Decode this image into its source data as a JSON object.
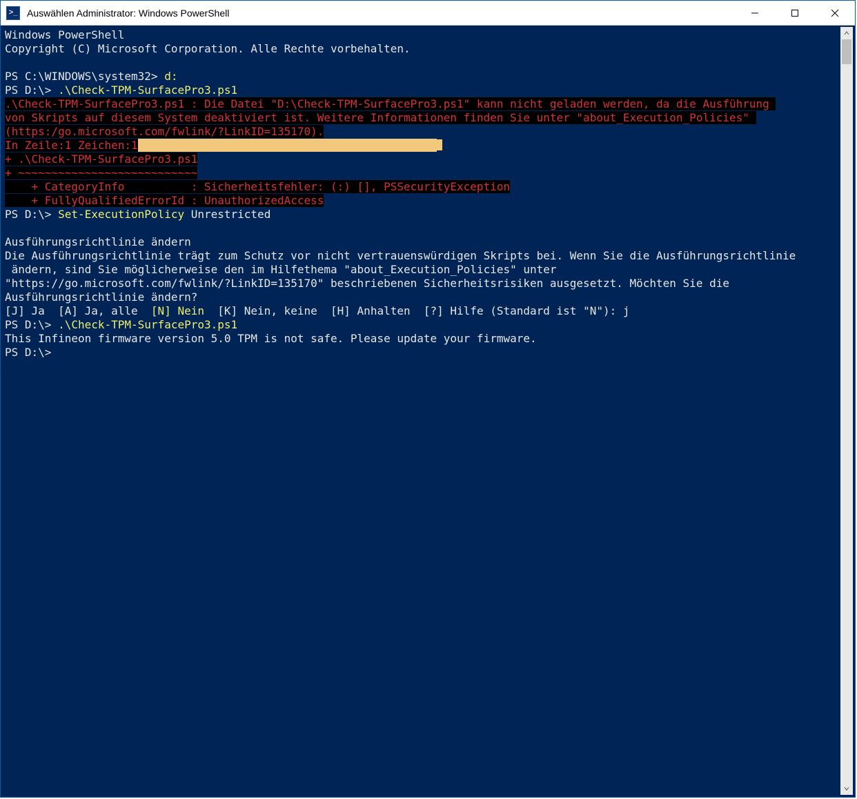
{
  "window": {
    "title": "Auswählen Administrator: Windows PowerShell"
  },
  "term": {
    "l0": "Windows PowerShell",
    "l1": "Copyright (C) Microsoft Corporation. Alle Rechte vorbehalten.",
    "p1_prompt": "PS C:\\WINDOWS\\system32> ",
    "p1_cmd": "d:",
    "p2_prompt": "PS D:\\> ",
    "p2_cmd": ".\\Check-TPM-SurfacePro3.ps1",
    "err1": ".\\Check-TPM-SurfacePro3.ps1 : Die Datei \"D:\\Check-TPM-SurfacePro3.ps1\" kann nicht geladen werden, da die Ausführung ",
    "err2": "von Skripts auf diesem System deaktiviert ist. Weitere Informationen finden Sie unter \"about_Execution_Policies\" ",
    "err3": "(https:/go.microsoft.com/fwlink/?LinkID=135170).",
    "err4": "In Zeile:1 Zeichen:1",
    "err5": "+ .\\Check-TPM-SurfacePro3.ps1",
    "err6": "+ ~~~~~~~~~~~~~~~~~~~~~~~~~~~",
    "err7": "    + CategoryInfo          : Sicherheitsfehler: (:) [], PSSecurityException",
    "err8": "    + FullyQualifiedErrorId : UnauthorizedAccess",
    "p3_prompt": "PS D:\\> ",
    "p3_cmd1": "Set-ExecutionPolicy",
    "p3_arg": " Unrestricted",
    "policy_head": "Ausführungsrichtlinie ändern",
    "policy_body1": "Die Ausführungsrichtlinie trägt zum Schutz vor nicht vertrauenswürdigen Skripts bei. Wenn Sie die Ausführungsrichtlinie",
    "policy_body2": " ändern, sind Sie möglicherweise den im Hilfethema \"about_Execution_Policies\" unter",
    "policy_body3": "\"https://go.microsoft.com/fwlink/?LinkID=135170\" beschriebenen Sicherheitsrisiken ausgesetzt. Möchten Sie die",
    "policy_body4": "Ausführungsrichtlinie ändern?",
    "opt_j": "[J] Ja  ",
    "opt_a": "[A] Ja, alle  ",
    "opt_n": "[N] Nein",
    "opt_k": "  [K] Nein, keine  ",
    "opt_h": "[H] Anhalten  ",
    "opt_help": "[?] Hilfe (Standard ist \"N\"): ",
    "opt_ans": "j",
    "p4_prompt": "PS D:\\> ",
    "p4_cmd": ".\\Check-TPM-SurfacePro3.ps1",
    "out1": "This Infineon firmware version 5.0 TPM is not safe. Please update your firmware.",
    "p5_prompt": "PS D:\\> "
  }
}
